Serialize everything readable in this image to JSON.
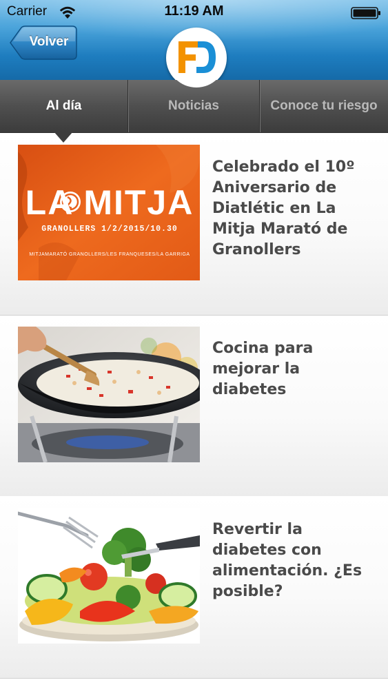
{
  "status_bar": {
    "carrier": "Carrier",
    "time": "11:19 AM",
    "wifi_icon": "wifi-icon",
    "battery_icon": "battery-icon"
  },
  "header": {
    "back_label": "Volver",
    "logo_text": "FD",
    "colors": {
      "brand_orange": "#f39200",
      "brand_blue": "#1a8fd6",
      "header_blue": "#1e7dbf"
    }
  },
  "tabs": [
    {
      "label": "Al día",
      "active": true
    },
    {
      "label": "Noticias",
      "active": false
    },
    {
      "label": "Conoce tu riesgo",
      "active": false
    }
  ],
  "news": [
    {
      "title": "Celebrado el 10º Aniversario de Diatlétic en La Mitja Marató de Granollers",
      "image": {
        "type": "race-poster",
        "heading": "LA MITJA",
        "subline": "GRANOLLERS 1/2/2015/10.30",
        "footer": "MITJAMARATÓ GRANOLLERS/LES FRANQUESES/LA GARRIGA",
        "color": "#e8601c"
      }
    },
    {
      "title": "Cocina para mejorar la diabetes",
      "image": {
        "type": "photo-wok-rice"
      }
    },
    {
      "title": "Revertir la diabetes con alimentación. ¿Es posible?",
      "image": {
        "type": "photo-salad-fork"
      }
    }
  ]
}
